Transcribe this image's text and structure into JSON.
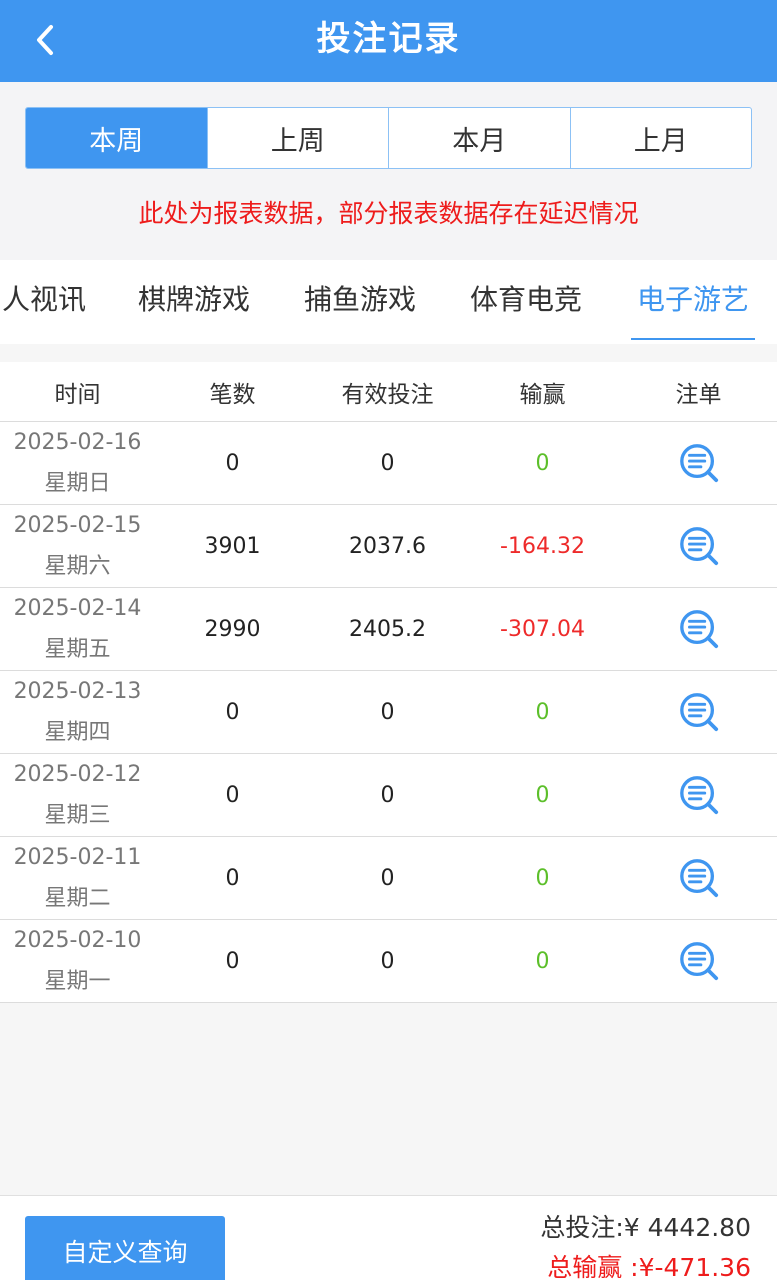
{
  "header": {
    "title": "投注记录"
  },
  "period_tabs": [
    "本周",
    "上周",
    "本月",
    "上月"
  ],
  "notice": "此处为报表数据，部分报表数据存在延迟情况",
  "categories": [
    "人视讯",
    "棋牌游戏",
    "捕鱼游戏",
    "体育电竞",
    "电子游艺"
  ],
  "table": {
    "headers": [
      "时间",
      "笔数",
      "有效投注",
      "输赢",
      "注单"
    ],
    "rows": [
      {
        "date": "2025-02-16",
        "weekday": "星期日",
        "count": "0",
        "valid_bet": "0",
        "win_loss": "0"
      },
      {
        "date": "2025-02-15",
        "weekday": "星期六",
        "count": "3901",
        "valid_bet": "2037.6",
        "win_loss": "-164.32"
      },
      {
        "date": "2025-02-14",
        "weekday": "星期五",
        "count": "2990",
        "valid_bet": "2405.2",
        "win_loss": "-307.04"
      },
      {
        "date": "2025-02-13",
        "weekday": "星期四",
        "count": "0",
        "valid_bet": "0",
        "win_loss": "0"
      },
      {
        "date": "2025-02-12",
        "weekday": "星期三",
        "count": "0",
        "valid_bet": "0",
        "win_loss": "0"
      },
      {
        "date": "2025-02-11",
        "weekday": "星期二",
        "count": "0",
        "valid_bet": "0",
        "win_loss": "0"
      },
      {
        "date": "2025-02-10",
        "weekday": "星期一",
        "count": "0",
        "valid_bet": "0",
        "win_loss": "0"
      }
    ]
  },
  "footer": {
    "custom_query_label": "自定义查询",
    "total_bet": "总投注:¥ 4442.80",
    "total_win_loss": "总输赢 :¥-471.36"
  },
  "colors": {
    "primary": "#3f96f0",
    "negative": "#ee2a2a",
    "zero": "#5cbf2a",
    "notice": "#ee1c1c"
  },
  "icons": {
    "back": "chevron-left-icon",
    "detail": "search-list-icon"
  }
}
